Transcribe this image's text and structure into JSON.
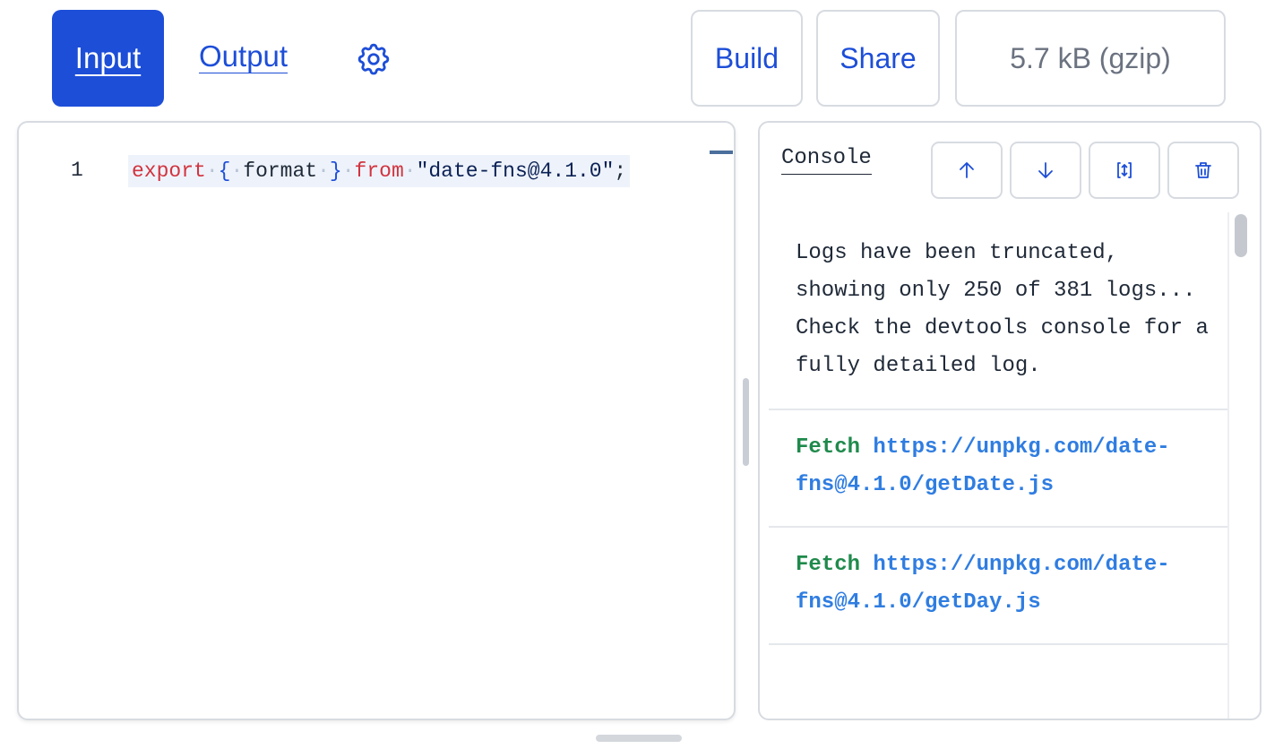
{
  "toolbar": {
    "input_tab": "Input",
    "output_tab": "Output",
    "settings_icon": "gear-icon",
    "build_label": "Build",
    "share_label": "Share",
    "size_label": "5.7 kB (gzip)"
  },
  "editor": {
    "line_number": "1",
    "code": {
      "kw_export": "export",
      "open_brace": "{",
      "ident": "format",
      "close_brace": "}",
      "kw_from": "from",
      "string": "\"date-fns@4.1.0\"",
      "semicolon": ";"
    }
  },
  "console": {
    "title": "Console",
    "buttons": [
      "arrow-up-icon",
      "arrow-down-icon",
      "expand-vertical-icon",
      "trash-icon"
    ],
    "truncation_notice": "Logs have been truncated, showing only 250 of 381 logs... Check the devtools console for a fully detailed log.",
    "logs": [
      {
        "verb": "Fetch",
        "url": "https://unpkg.com/date-fns@4.1.0/getDate.js"
      },
      {
        "verb": "Fetch",
        "url": "https://unpkg.com/date-fns@4.1.0/getDay.js"
      }
    ]
  },
  "colors": {
    "accent": "#1d4ed8",
    "keyword": "#d1343f",
    "fetch_green": "#1f8a4c",
    "link_blue": "#2f7de1"
  }
}
